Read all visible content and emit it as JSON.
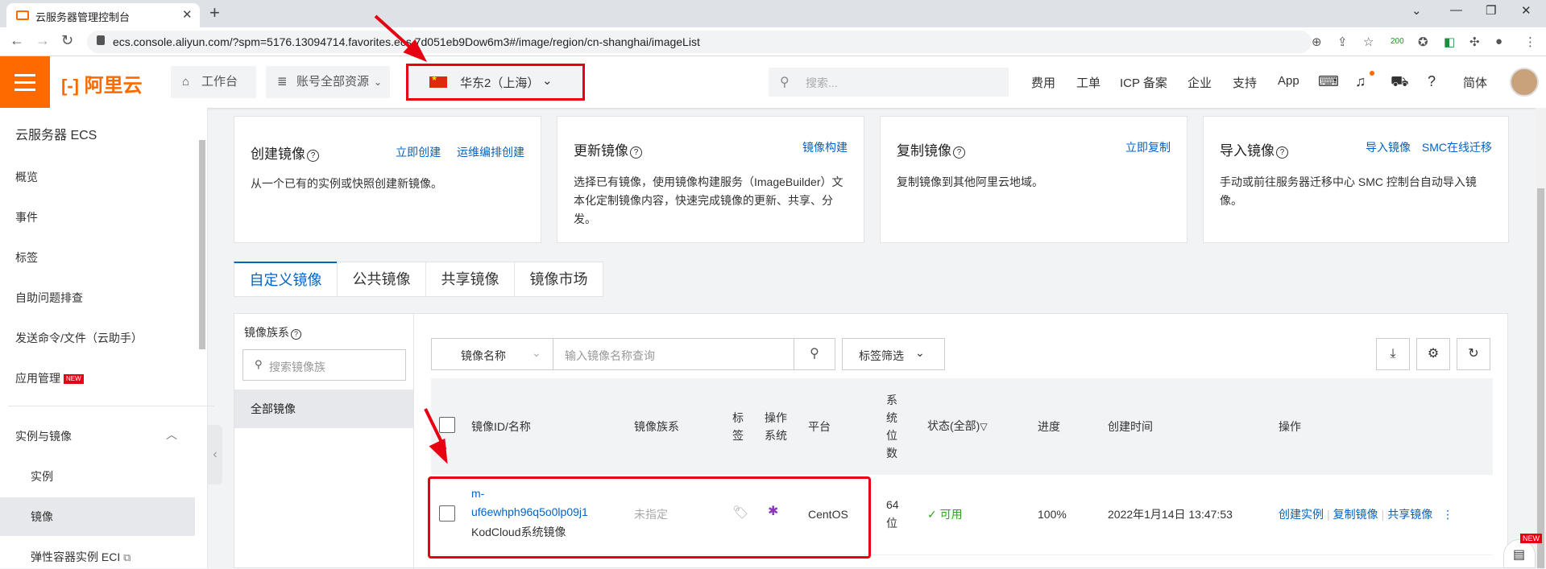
{
  "browser": {
    "tab_title": "云服务器管理控制台",
    "url": "ecs.console.aliyun.com/?spm=5176.13094714.favorites.ecs.7d051eb9Dow6m3#/image/region/cn-shanghai/imageList",
    "ext_badge": "200"
  },
  "topnav": {
    "logo": "阿里云",
    "workbench": "工作台",
    "resources": "账号全部资源",
    "region": "华东2（上海）",
    "search_placeholder": "搜索...",
    "links": [
      "费用",
      "工单",
      "ICP 备案",
      "企业",
      "支持",
      "App"
    ],
    "lang": "简体"
  },
  "sidebar": {
    "title": "云服务器 ECS",
    "items": [
      "概览",
      "事件",
      "标签",
      "自助问题排查",
      "发送命令/文件（云助手）",
      "应用管理"
    ],
    "new_badge": "NEW",
    "group": "实例与镜像",
    "sub_items": [
      "实例",
      "镜像",
      "弹性容器实例 ECI"
    ]
  },
  "cards": [
    {
      "title": "创建镜像",
      "links": [
        "立即创建",
        "运维编排创建"
      ],
      "desc": "从一个已有的实例或快照创建新镜像。"
    },
    {
      "title": "更新镜像",
      "links": [
        "镜像构建"
      ],
      "desc": "选择已有镜像，使用镜像构建服务（ImageBuilder）文本化定制镜像内容，快速完成镜像的更新、共享、分发。"
    },
    {
      "title": "复制镜像",
      "links": [
        "立即复制"
      ],
      "desc": "复制镜像到其他阿里云地域。"
    },
    {
      "title": "导入镜像",
      "links": [
        "导入镜像",
        "SMC在线迁移"
      ],
      "desc": "手动或前往服务器迁移中心 SMC 控制台自动导入镜像。"
    }
  ],
  "tabs": [
    "自定义镜像",
    "公共镜像",
    "共享镜像",
    "镜像市场"
  ],
  "family": {
    "title": "镜像族系",
    "search_placeholder": "搜索镜像族",
    "all": "全部镜像"
  },
  "filter": {
    "select_value": "镜像名称",
    "input_placeholder": "输入镜像名称查询",
    "tag_filter": "标签筛选"
  },
  "table": {
    "headers": {
      "id": "镜像ID/名称",
      "family": "镜像族系",
      "tag": "标签",
      "os": "操作系统",
      "platform": "平台",
      "bits": "系统位数",
      "status": "状态(全部)",
      "progress": "进度",
      "created": "创建时间",
      "actions": "操作"
    },
    "rows": [
      {
        "id_part1": "m-",
        "id_part2": "uf6ewhph96q5o0lp09j1",
        "name": "KodCloud系统镜像",
        "family": "未指定",
        "platform": "CentOS",
        "bits_1": "64",
        "bits_2": "位",
        "status": "可用",
        "progress": "100%",
        "created": "2022年1月14日 13:47:53",
        "actions": [
          "创建实例",
          "复制镜像",
          "共享镜像"
        ]
      }
    ]
  },
  "fab_badge": "NEW",
  "colors": {
    "brand": "#ff6a00",
    "link": "#0064c8",
    "highlight": "#e60012",
    "status_ok": "#2aa515"
  }
}
